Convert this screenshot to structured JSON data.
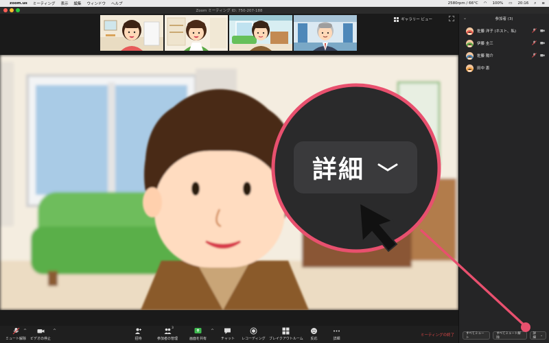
{
  "menubar": {
    "app_name": "zoom.us",
    "items": [
      "ミーティング",
      "表示",
      "編集",
      "ウィンドウ",
      "ヘルプ"
    ],
    "status": "2580rpm / 66°C",
    "battery": "100%",
    "time": "20:16"
  },
  "window": {
    "title": "Zoom ミーティング ID: 750-207-188",
    "gallery_view_label": "ギャラリー ビュー"
  },
  "callout": {
    "label": "詳細",
    "accent": "#e8506e"
  },
  "toolbar": {
    "unmute": "ミュート解除",
    "stop_video": "ビデオの停止",
    "invite": "招待",
    "manage_participants": "参加者の管理",
    "participant_count": "3",
    "share_screen": "画面を共有",
    "chat": "チャット",
    "record": "レコーディング",
    "breakout": "ブレイクアウトルーム",
    "reactions": "反応",
    "more": "詳細",
    "end_meeting": "ミーティングの終了"
  },
  "panel": {
    "title": "参加者 (3)",
    "participants": [
      {
        "name": "佐藤 洋子 (ホスト、私)"
      },
      {
        "name": "伊藤 圭三"
      },
      {
        "name": "佐藤 陽介"
      },
      {
        "name": "田中 恵"
      }
    ],
    "mute_all": "すべてミュート",
    "unmute_all": "すべてミュート解除",
    "more": "詳細"
  }
}
